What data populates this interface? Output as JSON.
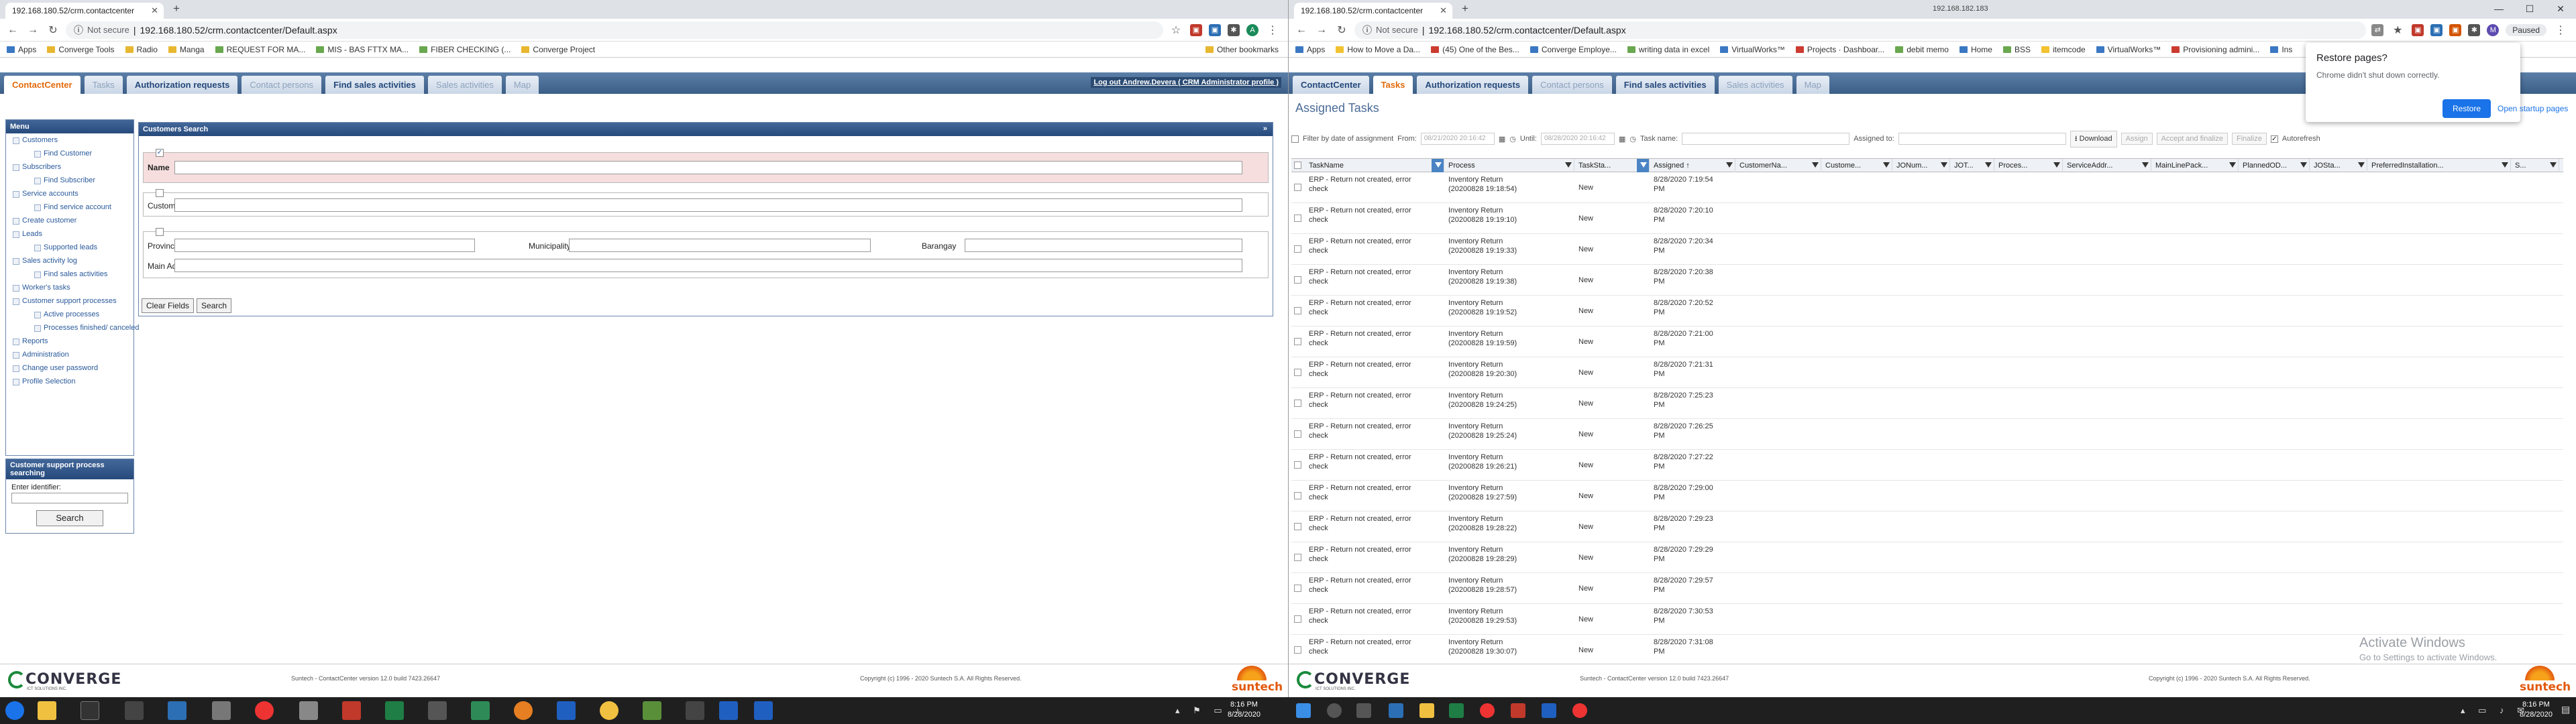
{
  "left_browser": {
    "tab_title": "192.168.180.52/crm.contactcenter",
    "not_secure": "Not secure",
    "url": "192.168.180.52/crm.contactcenter/Default.aspx",
    "bookmarks": [
      "Apps",
      "Converge Tools",
      "Radio",
      "Manga",
      "REQUEST FOR MA...",
      "MIS - BAS FTTX MA...",
      "FIBER CHECKING (...",
      "Converge Project"
    ],
    "other_bookmarks": "Other bookmarks"
  },
  "right_browser": {
    "tab_title": "192.168.180.52/crm.contactcenter",
    "not_secure": "Not secure",
    "url": "192.168.180.52/crm.contactcenter/Default.aspx",
    "bookmarks": [
      "Apps",
      "How to Move a Da...",
      "(45) One of the Bes...",
      "Converge Employe...",
      "writing data in excel",
      "VirtualWorks™",
      "Projects · Dashboar...",
      "debit memo",
      "Home",
      "BSS",
      "itemcode",
      "VirtualWorks™",
      "Provisioning admini...",
      "Ins"
    ],
    "profile_status": "Paused",
    "title_ip": "192.168.182.183"
  },
  "left_app": {
    "tabs": [
      "ContactCenter",
      "Tasks",
      "Authorization requests",
      "Contact persons",
      "Find sales activities",
      "Sales activities",
      "Map"
    ],
    "logout": "Log out Andrew.Devera ( CRM Administrator profile )",
    "menu_title": "Menu",
    "menu_items": [
      {
        "label": "Customers",
        "sub": false
      },
      {
        "label": "Find Customer",
        "sub": true
      },
      {
        "label": "Subscribers",
        "sub": false
      },
      {
        "label": "Find Subscriber",
        "sub": true
      },
      {
        "label": "Service accounts",
        "sub": false
      },
      {
        "label": "Find service account",
        "sub": true
      },
      {
        "label": "Create customer",
        "sub": false
      },
      {
        "label": "Leads",
        "sub": false
      },
      {
        "label": "Supported leads",
        "sub": true
      },
      {
        "label": "Sales activity log",
        "sub": false
      },
      {
        "label": "Find sales activities",
        "sub": true
      },
      {
        "label": "Worker's tasks",
        "sub": false
      },
      {
        "label": "Customer support processes",
        "sub": false
      },
      {
        "label": "Active processes",
        "sub": true
      },
      {
        "label": "Processes finished/ canceled",
        "sub": true
      },
      {
        "label": "Reports",
        "sub": false
      },
      {
        "label": "Administration",
        "sub": false
      },
      {
        "label": "Change user password",
        "sub": false
      },
      {
        "label": "Profile Selection",
        "sub": false
      }
    ],
    "csp_title": "Customer support process searching",
    "csp_label": "Enter identifier:",
    "csp_button": "Search",
    "search_title": "Customers Search",
    "search_collapse": "»",
    "name_label": "Name",
    "customer_id_label": "Customer ID",
    "province_label": "Province",
    "municipality_label": "Municipality/City",
    "barangay_label": "Barangay",
    "main_address_label": "Main Address",
    "clear_button": "Clear Fields",
    "search_button": "Search"
  },
  "right_app": {
    "tabs": [
      "ContactCenter",
      "Tasks",
      "Authorization requests",
      "Contact persons",
      "Find sales activities",
      "Sales activities",
      "Map"
    ],
    "header": "Assigned Tasks",
    "filter_by_date": "Filter by date of assignment",
    "from_label": "From:",
    "from_value": "08/21/2020 20:16:42",
    "until_label": "Until:",
    "until_value": "08/28/2020 20:16:42",
    "task_name_label": "Task name:",
    "assigned_to_label": "Assigned to:",
    "download": "Download",
    "assign": "Assign",
    "accept_finalize": "Accept and finalize",
    "finalize": "Finalize",
    "autorefresh": "Autorefresh",
    "columns": [
      "TaskName",
      "Process",
      "TaskSta...",
      "Assigned ↑",
      "CustomerNa...",
      "Custome...",
      "JONum...",
      "JOT...",
      "Proces...",
      "ServiceAddr...",
      "MainLinePack...",
      "PlannedOD...",
      "JOSta...",
      "PreferredInstallation...",
      "S..."
    ],
    "rows": [
      {
        "task": "ERP - Return not created, error check",
        "process": "Inventory Return (20200828 19:18:54)",
        "status": "New",
        "assigned": "8/28/2020 7:19:54 PM"
      },
      {
        "task": "ERP - Return not created, error check",
        "process": "Inventory Return (20200828 19:19:10)",
        "status": "New",
        "assigned": "8/28/2020 7:20:10 PM"
      },
      {
        "task": "ERP - Return not created, error check",
        "process": "Inventory Return (20200828 19:19:33)",
        "status": "New",
        "assigned": "8/28/2020 7:20:34 PM"
      },
      {
        "task": "ERP - Return not created, error check",
        "process": "Inventory Return (20200828 19:19:38)",
        "status": "New",
        "assigned": "8/28/2020 7:20:38 PM"
      },
      {
        "task": "ERP - Return not created, error check",
        "process": "Inventory Return (20200828 19:19:52)",
        "status": "New",
        "assigned": "8/28/2020 7:20:52 PM"
      },
      {
        "task": "ERP - Return not created, error check",
        "process": "Inventory Return (20200828 19:19:59)",
        "status": "New",
        "assigned": "8/28/2020 7:21:00 PM"
      },
      {
        "task": "ERP - Return not created, error check",
        "process": "Inventory Return (20200828 19:20:30)",
        "status": "New",
        "assigned": "8/28/2020 7:21:31 PM"
      },
      {
        "task": "ERP - Return not created, error check",
        "process": "Inventory Return (20200828 19:24:25)",
        "status": "New",
        "assigned": "8/28/2020 7:25:23 PM"
      },
      {
        "task": "ERP - Return not created, error check",
        "process": "Inventory Return (20200828 19:25:24)",
        "status": "New",
        "assigned": "8/28/2020 7:26:25 PM"
      },
      {
        "task": "ERP - Return not created, error check",
        "process": "Inventory Return (20200828 19:26:21)",
        "status": "New",
        "assigned": "8/28/2020 7:27:22 PM"
      },
      {
        "task": "ERP - Return not created, error check",
        "process": "Inventory Return (20200828 19:27:59)",
        "status": "New",
        "assigned": "8/28/2020 7:29:00 PM"
      },
      {
        "task": "ERP - Return not created, error check",
        "process": "Inventory Return (20200828 19:28:22)",
        "status": "New",
        "assigned": "8/28/2020 7:29:23 PM"
      },
      {
        "task": "ERP - Return not created, error check",
        "process": "Inventory Return (20200828 19:28:29)",
        "status": "New",
        "assigned": "8/28/2020 7:29:29 PM"
      },
      {
        "task": "ERP - Return not created, error check",
        "process": "Inventory Return (20200828 19:28:57)",
        "status": "New",
        "assigned": "8/28/2020 7:29:57 PM"
      },
      {
        "task": "ERP - Return not created, error check",
        "process": "Inventory Return (20200828 19:29:53)",
        "status": "New",
        "assigned": "8/28/2020 7:30:53 PM"
      },
      {
        "task": "ERP - Return not created, error check",
        "process": "Inventory Return (20200828 19:30:07)",
        "status": "New",
        "assigned": "8/28/2020 7:31:08 PM"
      }
    ]
  },
  "restore_popup": {
    "title": "Restore pages?",
    "message": "Chrome didn't shut down correctly.",
    "restore_button": "Restore",
    "open_startup": "Open startup pages"
  },
  "activate_windows": {
    "line1": "Activate Windows",
    "line2": "Go to Settings to activate Windows."
  },
  "footer": {
    "brand": "CONVERGE",
    "brand_sub": "ICT SOLUTIONS INC.",
    "version": "Suntech - ContactCenter version 12.0 build 7423.26647",
    "copyright": "Copyright (c) 1996 - 2020 Suntech S.A. All Rights Reserved.",
    "suntech": "suntech"
  },
  "taskbar": {
    "left_time": "8:16 PM",
    "left_date": "8/28/2020",
    "right_time": "8:16 PM",
    "right_date": "8/28/2020"
  }
}
